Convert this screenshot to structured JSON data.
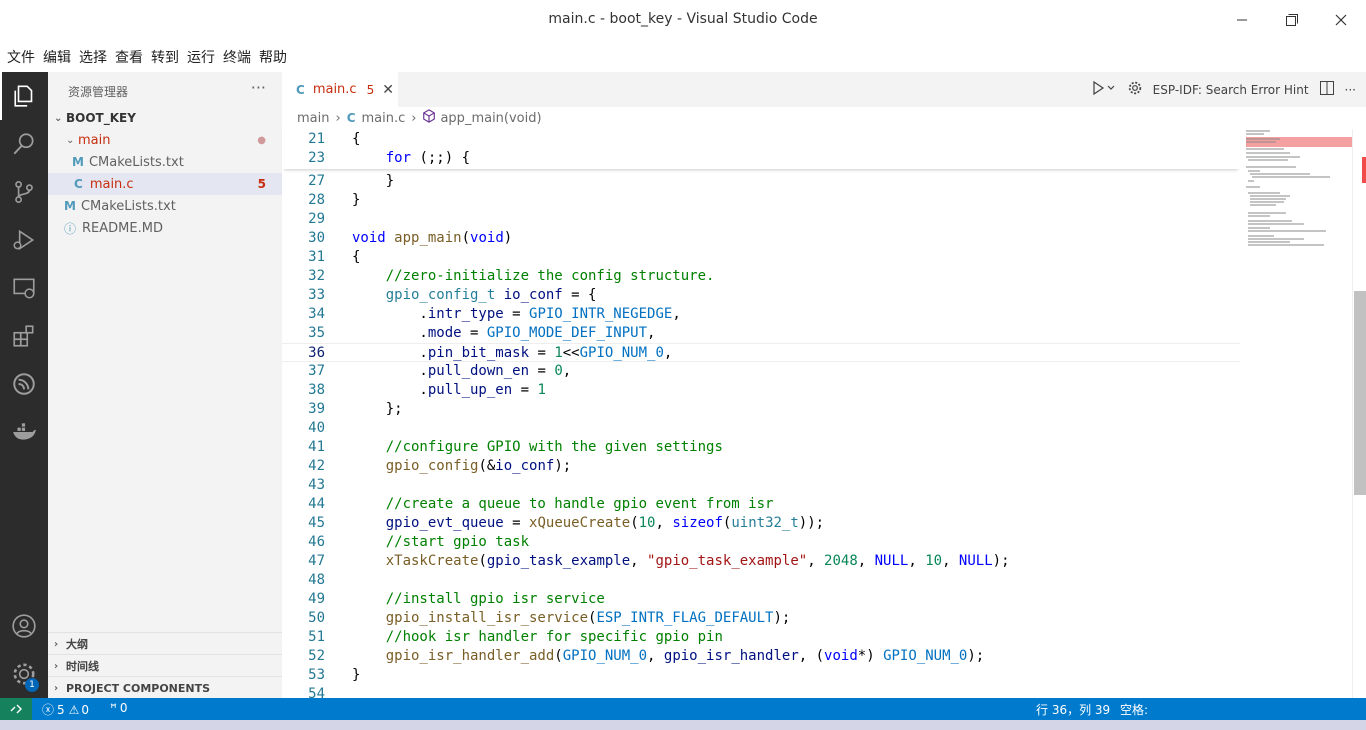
{
  "window": {
    "title": "main.c - boot_key - Visual Studio Code",
    "minimize_icon": "minimize-icon",
    "maximize_icon": "maximize-icon",
    "close_icon": "close-icon"
  },
  "menu": [
    "文件",
    "编辑",
    "选择",
    "查看",
    "转到",
    "运行",
    "终端",
    "帮助"
  ],
  "activity": {
    "items": [
      "explorer-icon",
      "search-icon",
      "source-control-icon",
      "run-debug-icon",
      "remote-explorer-icon",
      "extensions-icon",
      "esp-idf-icon",
      "docker-icon"
    ],
    "bottom": [
      "account-icon",
      "manage-gear-icon"
    ],
    "manage_badge": "1"
  },
  "sidebar": {
    "header": "资源管理器",
    "more": "···",
    "root": "BOOT_KEY",
    "tree": [
      {
        "label": "main",
        "kind": "folder",
        "indent": 1,
        "decoration": "●"
      },
      {
        "label": "CMakeLists.txt",
        "kind": "M",
        "indent": 2,
        "decoration": ""
      },
      {
        "label": "main.c",
        "kind": "C",
        "indent": 2,
        "decoration": "5",
        "selected": true
      },
      {
        "label": "CMakeLists.txt",
        "kind": "M",
        "indent": 1,
        "decoration": ""
      },
      {
        "label": "README.MD",
        "kind": "i",
        "indent": 1,
        "decoration": ""
      }
    ],
    "sections": [
      "大纲",
      "时间线",
      "PROJECT COMPONENTS"
    ]
  },
  "tab": {
    "icon": "C",
    "name": "main.c",
    "problems": "5",
    "close": "✕"
  },
  "tab_actions": {
    "run_icon": "run-debug-dropdown-icon",
    "gear_icon": "gear-icon",
    "esp_hint": "ESP-IDF: Search Error Hint",
    "split_icon": "split-editor-icon",
    "more": "···"
  },
  "breadcrumb": {
    "folder": "main",
    "sep": "›",
    "file_icon": "C",
    "file": "main.c",
    "symbol": "app_main(void)"
  },
  "code": {
    "sticky": [
      {
        "num": "21",
        "html": "{"
      },
      {
        "num": "23",
        "html": "    <span class='kw'>for</span> (;;) {"
      }
    ],
    "lines": [
      {
        "num": "27",
        "html": "    }"
      },
      {
        "num": "28",
        "html": "}"
      },
      {
        "num": "29",
        "html": ""
      },
      {
        "num": "30",
        "html": "<span class='kw'>void</span> <span class='fn'>app_main</span>(<span class='kw'>void</span>)"
      },
      {
        "num": "31",
        "html": "{"
      },
      {
        "num": "32",
        "html": "    <span class='cm'>//zero-initialize the config structure.</span>"
      },
      {
        "num": "33",
        "html": "    <span class='ty'>gpio_config_t</span> <span class='va'>io_conf</span> = {"
      },
      {
        "num": "34",
        "html": "        .<span class='va'>intr_type</span> = <span class='ma'>GPIO_INTR_NEGEDGE</span>,"
      },
      {
        "num": "35",
        "html": "        .<span class='va'>mode</span> = <span class='ma'>GPIO_MODE_DEF_INPUT</span>,"
      },
      {
        "num": "36",
        "html": "        .<span class='va'>pin_bit_mask</span> = <span class='nu'>1</span>&lt;&lt;<span class='ma'>GPIO_NUM_0</span>,",
        "current": true
      },
      {
        "num": "37",
        "html": "        .<span class='va'>pull_down_en</span> = <span class='nu'>0</span>,"
      },
      {
        "num": "38",
        "html": "        .<span class='va'>pull_up_en</span> = <span class='nu'>1</span>"
      },
      {
        "num": "39",
        "html": "    };"
      },
      {
        "num": "40",
        "html": ""
      },
      {
        "num": "41",
        "html": "    <span class='cm'>//configure GPIO with the given settings</span>"
      },
      {
        "num": "42",
        "html": "    <span class='fn'>gpio_config</span>(&amp;<span class='va'>io_conf</span>);"
      },
      {
        "num": "43",
        "html": ""
      },
      {
        "num": "44",
        "html": "    <span class='cm'>//create a queue to handle gpio event from isr</span>"
      },
      {
        "num": "45",
        "html": "    <span class='va'>gpio_evt_queue</span> = <span class='fn'>xQueueCreate</span>(<span class='nu'>10</span>, <span class='kw'>sizeof</span>(<span class='ty'>uint32_t</span>));"
      },
      {
        "num": "46",
        "html": "    <span class='cm'>//start gpio task</span>"
      },
      {
        "num": "47",
        "html": "    <span class='fn'>xTaskCreate</span>(<span class='va'>gpio_task_example</span>, <span class='st'>\"gpio_task_example\"</span>, <span class='nu'>2048</span>, <span class='kw'>NULL</span>, <span class='nu'>10</span>, <span class='kw'>NULL</span>);"
      },
      {
        "num": "48",
        "html": ""
      },
      {
        "num": "49",
        "html": "    <span class='cm'>//install gpio isr service</span>"
      },
      {
        "num": "50",
        "html": "    <span class='fn'>gpio_install_isr_service</span>(<span class='ma'>ESP_INTR_FLAG_DEFAULT</span>);"
      },
      {
        "num": "51",
        "html": "    <span class='cm'>//hook isr handler for specific gpio pin</span>"
      },
      {
        "num": "52",
        "html": "    <span class='fn'>gpio_isr_handler_add</span>(<span class='ma'>GPIO_NUM_0</span>, <span class='va'>gpio_isr_handler</span>, (<span class='kw'>void</span>*) <span class='ma'>GPIO_NUM_0</span>);"
      },
      {
        "num": "53",
        "html": "}"
      },
      {
        "num": "54",
        "html": ""
      }
    ]
  },
  "status": {
    "remote_icon": "remote-icon",
    "errors": "5",
    "warnings": "0",
    "ports": "0",
    "position": "行 36，列 39",
    "spaces": "空格:"
  },
  "colors": {
    "activity_bg": "#2c2c2c",
    "sidebar_bg": "#f3f3f3",
    "status_bg": "#007acc",
    "remote_bg": "#16825d",
    "error_red": "#c72e0f",
    "badge_blue": "#0066b8"
  }
}
